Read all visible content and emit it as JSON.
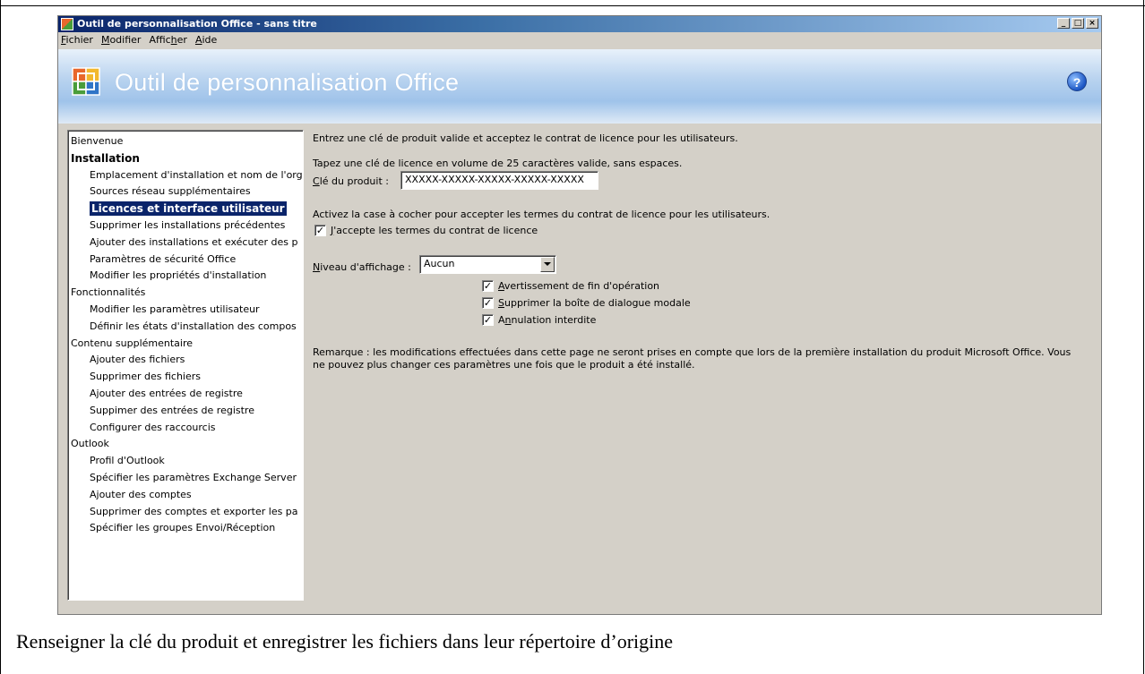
{
  "window": {
    "title": "Outil de personnalisation Office - sans titre",
    "controls": [
      "_",
      "□",
      "×"
    ]
  },
  "menu": [
    {
      "label": "Fichier",
      "access": "F",
      "rest": "ichier"
    },
    {
      "label": "Modifier",
      "access": "M",
      "rest": "odifier"
    },
    {
      "label": "Afficher",
      "pre": "Affic",
      "access": "h",
      "rest": "er"
    },
    {
      "label": "Aide",
      "access": "A",
      "rest": "ide"
    }
  ],
  "banner": {
    "title": "Outil de personnalisation Office",
    "help_icon": "question-circle-icon",
    "logo_icon": "office-logo-icon"
  },
  "tree": {
    "items": [
      {
        "label": "Bienvenue",
        "level": 0
      },
      {
        "label": "Installation",
        "level": 0,
        "bold": true
      },
      {
        "label": "Emplacement d'installation et nom de l'org",
        "level": 1
      },
      {
        "label": "Sources réseau supplémentaires",
        "level": 1
      },
      {
        "label": "Licences et interface utilisateur",
        "level": 1,
        "selected": true
      },
      {
        "label": "Supprimer les installations précédentes",
        "level": 1
      },
      {
        "label": "Ajouter des installations et exécuter des p",
        "level": 1
      },
      {
        "label": "Paramètres de sécurité Office",
        "level": 1
      },
      {
        "label": "Modifier les propriétés d'installation",
        "level": 1
      },
      {
        "label": "Fonctionnalités",
        "level": 0
      },
      {
        "label": "Modifier les paramètres utilisateur",
        "level": 1
      },
      {
        "label": "Définir les états d'installation des compos",
        "level": 1
      },
      {
        "label": "Contenu supplémentaire",
        "level": 0
      },
      {
        "label": "Ajouter des fichiers",
        "level": 1
      },
      {
        "label": "Supprimer des fichiers",
        "level": 1
      },
      {
        "label": "Ajouter des entrées de registre",
        "level": 1
      },
      {
        "label": "Suppimer des entrées de registre",
        "level": 1
      },
      {
        "label": "Configurer des raccourcis",
        "level": 1
      },
      {
        "label": "Outlook",
        "level": 0
      },
      {
        "label": "Profil d'Outlook",
        "level": 1
      },
      {
        "label": "Spécifier les paramètres Exchange Server",
        "level": 1
      },
      {
        "label": "Ajouter des comptes",
        "level": 1
      },
      {
        "label": "Supprimer des comptes et exporter les pa",
        "level": 1
      },
      {
        "label": "Spécifier les groupes Envoi/Réception",
        "level": 1
      }
    ]
  },
  "content": {
    "intro": "Entrez une clé de produit valide et acceptez le contrat de licence pour les utilisateurs.",
    "key_instruction": "Tapez une clé de licence en volume de 25 caractères valide, sans espaces.",
    "key_label_access": "C",
    "key_label_rest": "lé du produit :",
    "key_value": "XXXXX-XXXXX-XXXXX-XXXXX-XXXXX",
    "license_instruction": "Activez la case à cocher pour accepter les termes du contrat de licence pour les utilisateurs.",
    "accept_access": "J",
    "accept_rest": "'accepte les termes du contrat de licence",
    "accept_checked": true,
    "display_level_access": "N",
    "display_level_rest": "iveau d'affichage :",
    "display_level_value": "Aucun",
    "options": [
      {
        "access": "A",
        "rest": "vertissement de fin d'opération",
        "checked": true
      },
      {
        "access": "S",
        "rest": "upprimer la boîte de dialogue modale",
        "checked": true
      },
      {
        "pre": "A",
        "access": "n",
        "rest": "nulation interdite",
        "checked": true
      }
    ],
    "note_line1": "Remarque : les modifications effectuées dans cette page ne seront prises en compte que lors de la première installation du produit Microsoft Office. Vous",
    "note_line2": "ne pouvez plus changer ces paramètres une fois que le produit a été installé."
  },
  "caption": "Renseigner la clé du produit et enregistrer les fichiers dans leur répertoire d’origine"
}
